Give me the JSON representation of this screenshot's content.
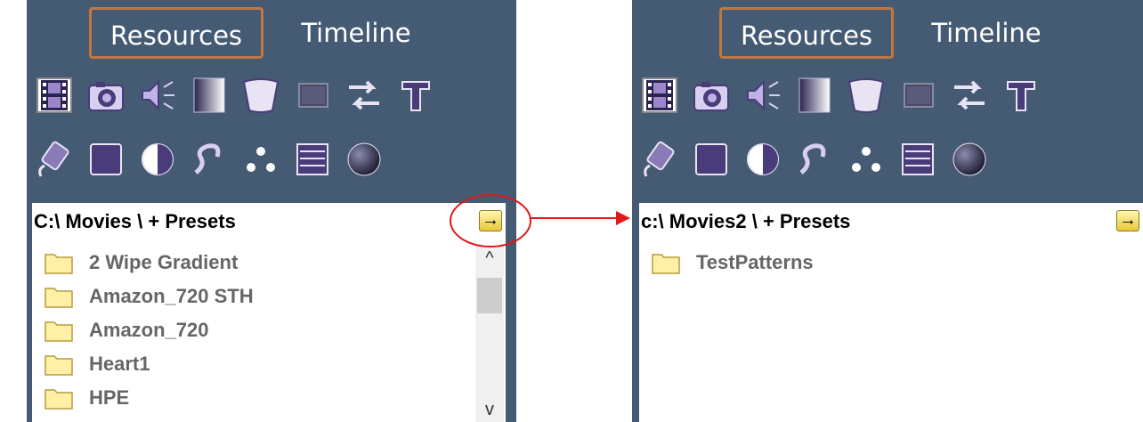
{
  "tabs": {
    "resources": "Resources",
    "timeline": "Timeline"
  },
  "icons": {
    "row1": [
      "film-icon",
      "camera-icon",
      "audio-icon",
      "gradient-icon",
      "shape-icon",
      "screen-icon",
      "swap-icon",
      "text-icon"
    ],
    "row2": [
      "effect-icon",
      "square-icon",
      "contrast-icon",
      "curve-icon",
      "particles-icon",
      "list-icon",
      "sphere-icon"
    ]
  },
  "left": {
    "path": "C:\\ Movies \\  + Presets",
    "go_button": "→",
    "items": [
      "2 Wipe Gradient",
      "Amazon_720 STH",
      "Amazon_720",
      "Heart1",
      "HPE"
    ],
    "scroll_up": "^",
    "scroll_down": "v"
  },
  "right": {
    "path": "c:\\ Movies2 \\  + Presets",
    "go_button": "→",
    "items": [
      "TestPatterns"
    ]
  },
  "colors": {
    "panel": "#455a73",
    "tab_border": "#c07840",
    "annotation": "#e01818",
    "icon_purple": "#4a3c7a"
  }
}
